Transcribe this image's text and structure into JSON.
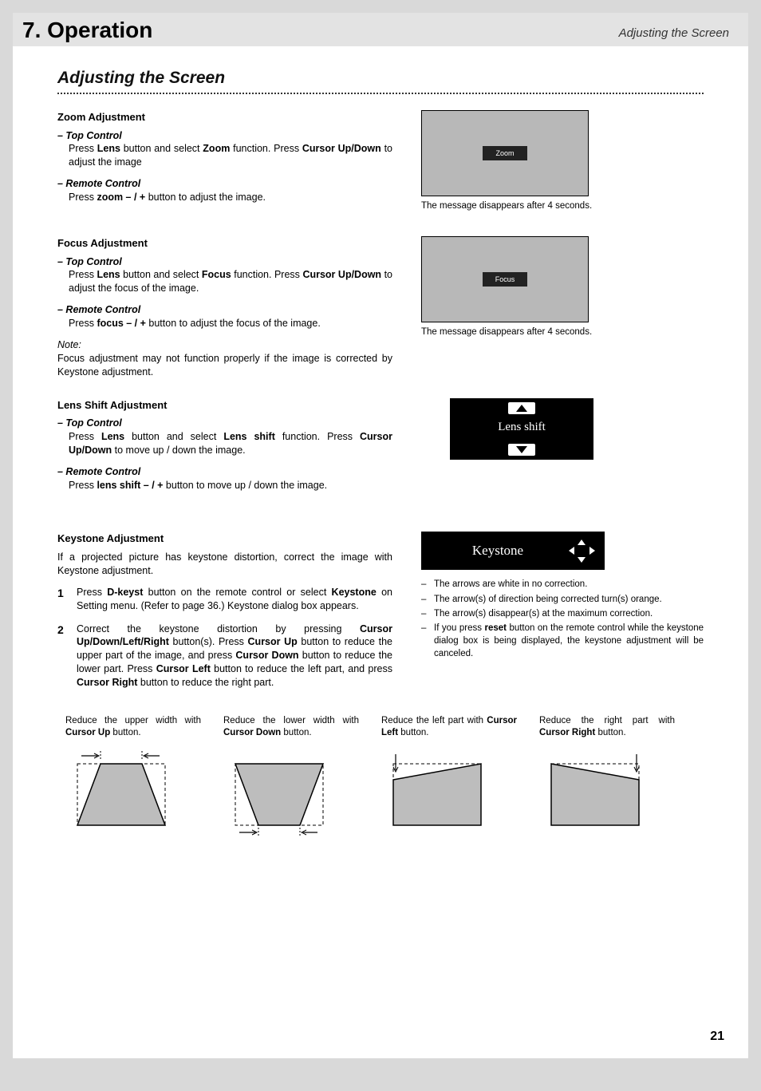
{
  "header": {
    "chapter": "7. Operation",
    "section_right": "Adjusting the Screen"
  },
  "title": "Adjusting the Screen",
  "zoom": {
    "heading": "Zoom Adjustment",
    "top_label": "– Top Control",
    "top_body_pre": "Press ",
    "top_body": "Lens button and select Zoom function. Press Cursor Up/Down",
    "top_body_post": " to adjust the image",
    "remote_label": "– Remote Control",
    "remote_body": "Press zoom – / + button to adjust the image.",
    "osd_label": "Zoom",
    "caption": "The message disappears after 4 seconds."
  },
  "focus": {
    "heading": "Focus Adjustment",
    "top_label": "– Top Control",
    "remote_label": "– Remote Control",
    "osd_label": "Focus",
    "caption": "The message disappears after 4 seconds.",
    "note_label": "Note:",
    "note_text": "Focus adjustment may not function properly if the image is corrected by Keystone adjustment."
  },
  "lens": {
    "heading": "Lens Shift Adjustment",
    "top_label": "– Top Control",
    "remote_label": "– Remote Control",
    "osd_label": "Lens shift"
  },
  "keystone": {
    "heading": "Keystone Adjustment",
    "intro": "If a projected picture has keystone distortion, correct the image with Keystone adjustment.",
    "osd_label": "Keystone",
    "bullets": [
      "The arrows are white in no correction.",
      "The arrow(s) of direction being corrected turn(s) orange.",
      "The arrow(s) disappear(s) at the maximum correction.",
      "If you press reset button on the remote control while the keystone dialog box is being displayed, the keystone adjustment will be canceled."
    ]
  },
  "diagrams": {
    "d1": "Reduce the upper width with Cursor Up button.",
    "d2": "Reduce the lower width with Cursor Down button.",
    "d3": "Reduce the left part with Cursor Left button.",
    "d4": "Reduce the right part with Cursor Right button."
  },
  "page_number": "21"
}
